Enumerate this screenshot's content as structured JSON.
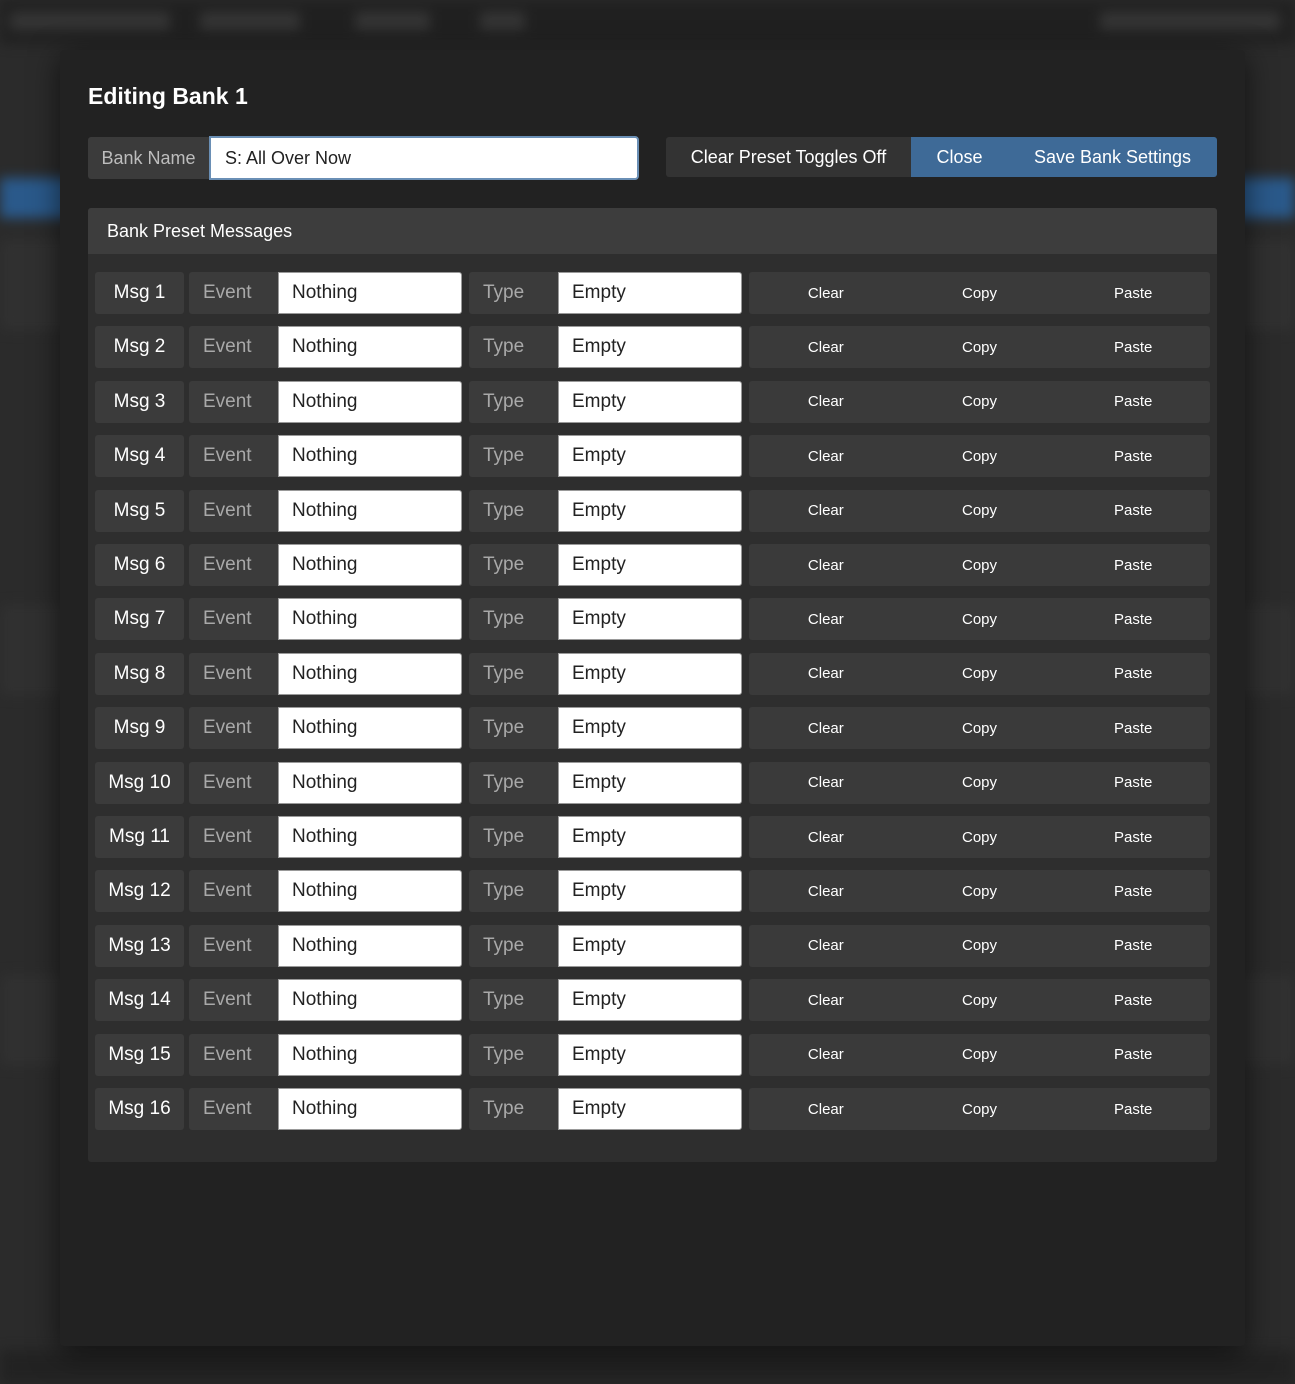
{
  "modal": {
    "title": "Editing Bank 1",
    "bank_name_label": "Bank Name",
    "bank_name_value": "S: All Over Now",
    "buttons": {
      "clear_toggles": "Clear Preset Toggles Off",
      "close": "Close",
      "save": "Save Bank Settings"
    },
    "panel_title": "Bank Preset Messages"
  },
  "row_labels": {
    "event": "Event",
    "type": "Type",
    "clear": "Clear",
    "copy": "Copy",
    "paste": "Paste"
  },
  "messages": [
    {
      "msg": "Msg 1",
      "event": "Nothing",
      "type": "Empty"
    },
    {
      "msg": "Msg 2",
      "event": "Nothing",
      "type": "Empty"
    },
    {
      "msg": "Msg 3",
      "event": "Nothing",
      "type": "Empty"
    },
    {
      "msg": "Msg 4",
      "event": "Nothing",
      "type": "Empty"
    },
    {
      "msg": "Msg 5",
      "event": "Nothing",
      "type": "Empty"
    },
    {
      "msg": "Msg 6",
      "event": "Nothing",
      "type": "Empty"
    },
    {
      "msg": "Msg 7",
      "event": "Nothing",
      "type": "Empty"
    },
    {
      "msg": "Msg 8",
      "event": "Nothing",
      "type": "Empty"
    },
    {
      "msg": "Msg 9",
      "event": "Nothing",
      "type": "Empty"
    },
    {
      "msg": "Msg 10",
      "event": "Nothing",
      "type": "Empty"
    },
    {
      "msg": "Msg 11",
      "event": "Nothing",
      "type": "Empty"
    },
    {
      "msg": "Msg 12",
      "event": "Nothing",
      "type": "Empty"
    },
    {
      "msg": "Msg 13",
      "event": "Nothing",
      "type": "Empty"
    },
    {
      "msg": "Msg 14",
      "event": "Nothing",
      "type": "Empty"
    },
    {
      "msg": "Msg 15",
      "event": "Nothing",
      "type": "Empty"
    },
    {
      "msg": "Msg 16",
      "event": "Nothing",
      "type": "Empty"
    }
  ],
  "colors": {
    "primary_button": "#3e6a97",
    "modal_background": "#222222",
    "panel_header": "#3d3d3d"
  }
}
